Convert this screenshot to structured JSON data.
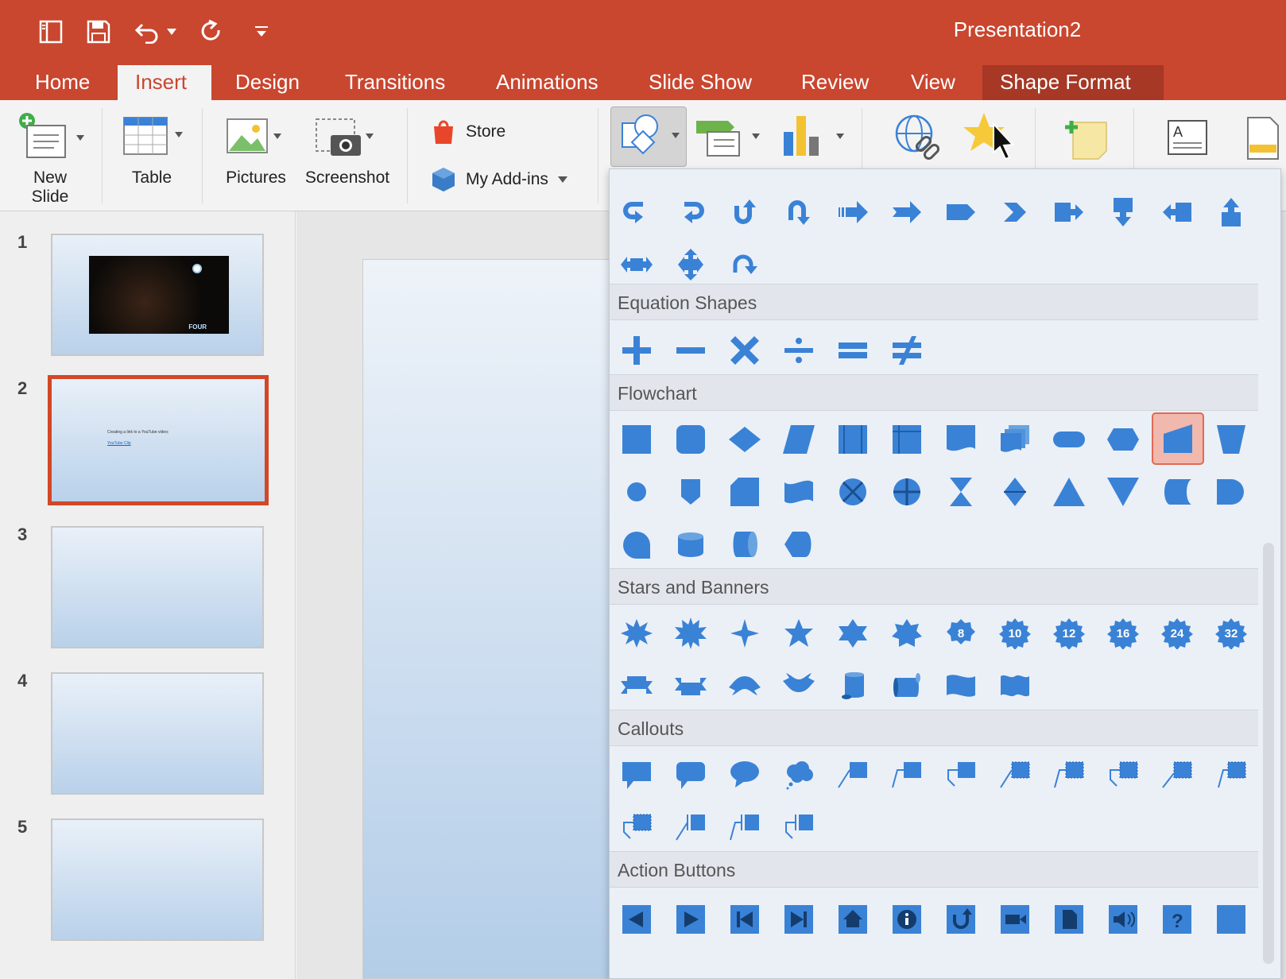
{
  "window": {
    "title": "Presentation2"
  },
  "quick_access": [
    {
      "icon": "sidebar-toggle-icon"
    },
    {
      "icon": "save-icon"
    },
    {
      "icon": "undo-icon"
    },
    {
      "icon": "undo-dropdown-icon"
    },
    {
      "icon": "redo-icon"
    },
    {
      "icon": "customize-toolbar-icon"
    }
  ],
  "tabs": [
    {
      "label": "Home"
    },
    {
      "label": "Insert",
      "active": true
    },
    {
      "label": "Design"
    },
    {
      "label": "Transitions"
    },
    {
      "label": "Animations"
    },
    {
      "label": "Slide Show"
    },
    {
      "label": "Review"
    },
    {
      "label": "View"
    },
    {
      "label": "Shape Format",
      "contextual": true
    }
  ],
  "ribbon": {
    "new_slide": "New\nSlide",
    "table": "Table",
    "pictures": "Pictures",
    "screenshot": "Screenshot",
    "store": "Store",
    "my_addins": "My Add-ins"
  },
  "colors": {
    "title_bar": "#c9462f",
    "active_tab_text": "#c9462f",
    "shape_fill": "#3a82d6",
    "shape_highlight": "#f1b8ae",
    "selected_slide_border": "#d24726"
  },
  "slides": [
    {
      "number": "1",
      "thumb_logo": "FOUR"
    },
    {
      "number": "2",
      "selected": true,
      "thumb_text": "Creating a link to a YouTube video;",
      "thumb_link": "YouTube Clip"
    },
    {
      "number": "3"
    },
    {
      "number": "4"
    },
    {
      "number": "5"
    }
  ],
  "shapes_gallery": {
    "sections": [
      {
        "title": "Equation Shapes"
      },
      {
        "title": "Flowchart"
      },
      {
        "title": "Stars and Banners"
      },
      {
        "title": "Callouts"
      },
      {
        "title": "Action Buttons"
      }
    ],
    "stars_labels": [
      "8",
      "10",
      "12",
      "16",
      "24",
      "32"
    ],
    "highlighted_shape": "flowchart-manual-input-icon"
  }
}
